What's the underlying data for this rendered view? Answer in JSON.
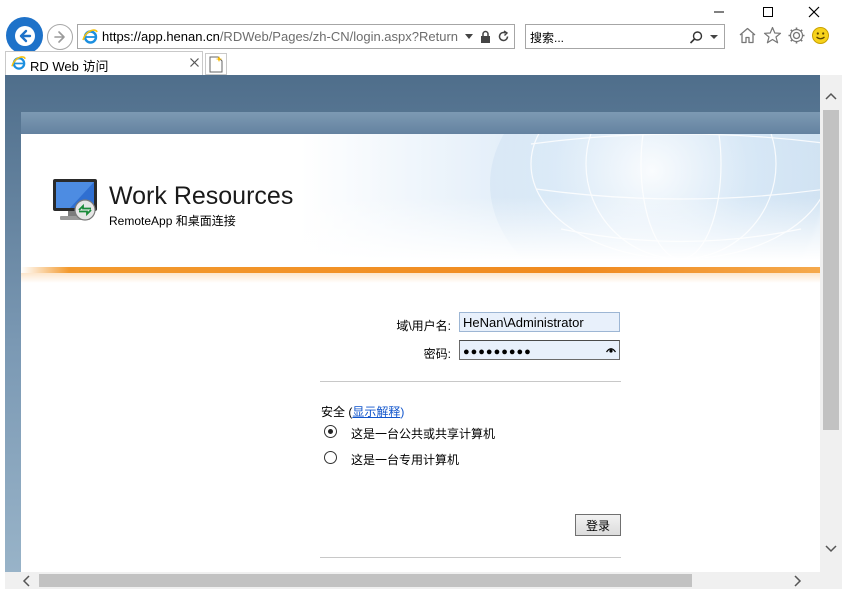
{
  "browser": {
    "address_host": "https://app.henan.cn",
    "address_path": "/RDWeb/Pages/zh-CN/login.aspx?Return",
    "search_placeholder": "搜索...",
    "tab_title": "RD Web 访问"
  },
  "header": {
    "title": "Work Resources",
    "subtitle": "RemoteApp 和桌面连接"
  },
  "form": {
    "username_label": "域\\用户名:",
    "username_value": "HeNan\\Administrator",
    "password_label": "密码:",
    "password_value": "●●●●●●●●●",
    "security_label": "安全 (",
    "security_link": "显示解释",
    "security_close": ")",
    "option_public": "这是一台公共或共享计算机",
    "option_private": "这是一台专用计算机",
    "selected_option": "public",
    "signin_button": "登录"
  },
  "icons": [
    "back-arrow-icon",
    "forward-arrow-icon",
    "ie-logo-icon",
    "lock-icon",
    "refresh-icon",
    "search-icon",
    "home-icon",
    "star-icon",
    "gear-icon",
    "smiley-icon",
    "remoteapp-logo-icon",
    "show-password-icon"
  ],
  "colors": {
    "accent_blue": "#1e72c9",
    "orange_line": "#f08a1f",
    "field_bg": "#e8f0fb"
  }
}
